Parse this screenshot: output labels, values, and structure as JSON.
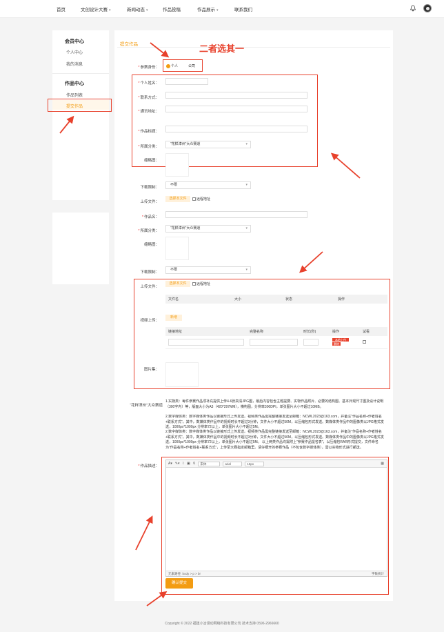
{
  "nav": {
    "items": [
      "首页",
      "文创设计大赛",
      "新闻动态",
      "作品投稿",
      "作品展示",
      "联系我们"
    ],
    "has_caret": [
      false,
      true,
      true,
      false,
      true,
      false
    ]
  },
  "sidebar": {
    "member_center": "会员中心",
    "personal_center": "个人中心",
    "my_messages": "我的消息",
    "works_center": "作品中心",
    "works_list": "作品列表",
    "submit_works": "提交作品"
  },
  "main": {
    "tab": "提交作品",
    "annotation": "二者选其一",
    "identity_label": "参赛身份：",
    "identity_options": [
      "个人",
      "公司"
    ],
    "name_label": "个人姓名：",
    "phone_label": "联系方式：",
    "address_label": "通讯地址：",
    "title_label": "作品标题：",
    "category_label": "所属分类：",
    "category_value": "“花样漳州”大众赛道",
    "thumb_label": "缩略图：",
    "download_label": "下载限制：",
    "download_value": "不限",
    "upload_label": "上传文件：",
    "upload_btn": "选择本文件",
    "remote_label": "远程地址",
    "work_name_label": "作品名：",
    "category2_label": "所属分类：",
    "category2_value": "“花样漳州”大众赛道",
    "thumb2_label": "缩略图：",
    "download2_label": "下载限制：",
    "download2_value": "不限",
    "upload2_label": "上传文件：",
    "upload2_btn": "选择本文件",
    "remote2_label": "远程地址",
    "file_table_headers": [
      "文件名",
      "大小",
      "状态",
      "操作"
    ],
    "video_upload_label": "视频上传：",
    "video_add_btn": "新增",
    "video_table_headers": [
      "链接地址",
      "完整名称",
      "时长(秒)",
      "操作",
      "试看"
    ],
    "video_op_btn1": "本地上传",
    "video_op_btn2": "删除",
    "image_set_label": "图片集：",
    "contest_label": "“花样漳州”大众赛道",
    "desc_para1": "1.实物类：每件参赛作品须补充提供上传4-6张高清JPG图，最后内容包含主题提要、实物作品照片、必要的结构图、基本外观尺寸图及设计说明（300字内）等，版面大小为A3（420*297MM），横构图，分辨率300DPI，单张图片大小不超过10MB。",
    "desc_para2": "2.数字媒体类：数字媒体类作品以链接形式上传发送。视频类作品需完整链接发送至邮箱：NCWL2023@163.com，并备注“作品名称+作者姓名+联系方式”。其中，数媒体类作品中的视频时长不超过3分钟，文件大小不超过50M，以压缩包形式发送。数媒体类作品中的图像类以JPG格式发送，1000px*1000px 分辨率72以上，单张图片大小不超过5M。",
    "desc_para3": "2.数字媒体类：数字媒体类作品以链接形式上传发送。视频类作品需完整链接发送至邮箱：NCWL2023@163.com，并备注“作品名称+作者姓名+联系方式”。其中，数媒体类作品中的视频时长不超过3分钟，文件大小不超过50M，以压缩包形式发送。数媒体类作品中的图像类以JPG格式发送，1000px*1000px 分辨率72以上，单张图片大小不超过5M。 以上两类作品均需附上“参赛作品提名表”，以压缩包RAR形式提交，文件命名为“作品名称+作者姓名+联系方式”，上传至大赛指定邮箱里。请仔细开的参赛作品（不包含数字媒体类），需以实物形式进行邮送。",
    "content_label": "作品描述：",
    "editor_font": "宋体",
    "editor_font2": "arial",
    "editor_size": "16px",
    "editor_status": "元素路径: body > p > br",
    "editor_count": "字数统计",
    "submit": "确认提交"
  },
  "footer": "Copyright © 2022 福建小冶漫动网络科技有限公司 技术支持 0596-2966660",
  "colors": {
    "accent": "#f39c12",
    "annotation": "#e8412c"
  }
}
